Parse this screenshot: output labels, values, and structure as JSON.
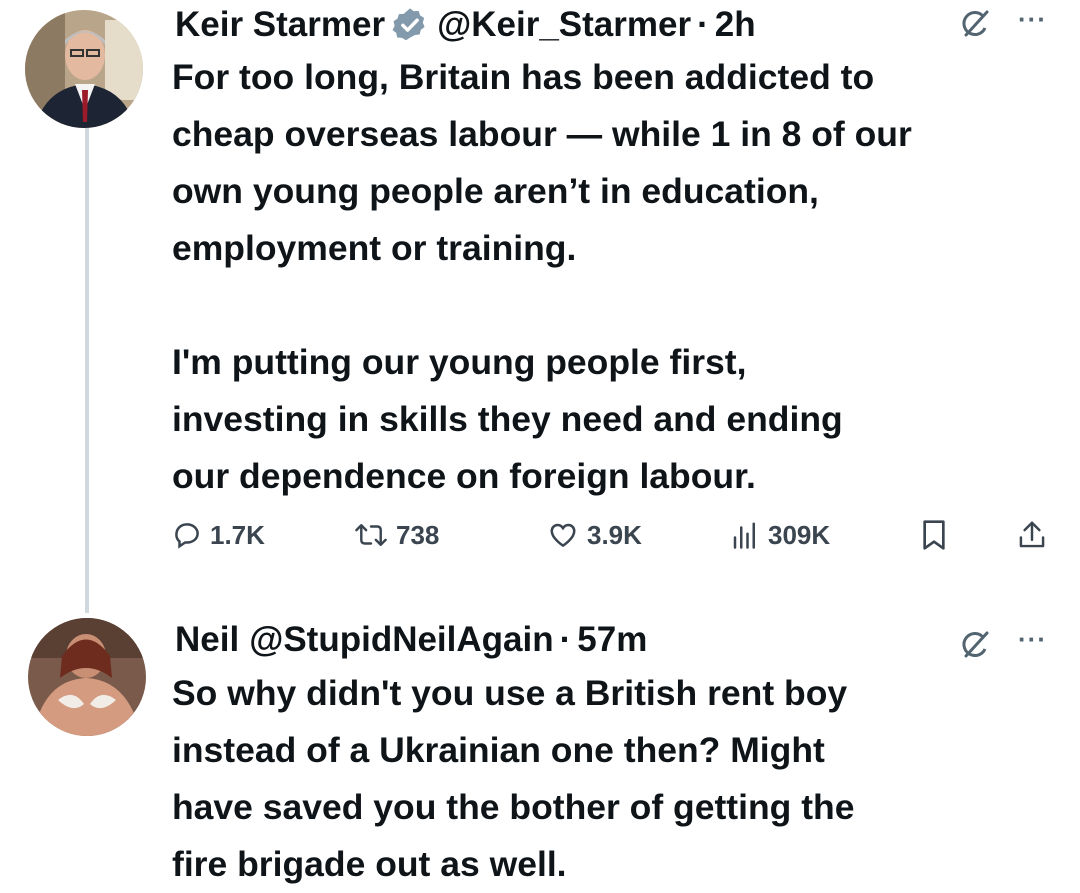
{
  "tweet": {
    "author_name": "Keir Starmer",
    "handle": "@Keir_Starmer",
    "separator": "·",
    "time": "2h",
    "text": "For too long, Britain has been addicted to\ncheap overseas labour — while 1 in 8 of our\nown young people aren’t in education,\nemployment or training.\n\nI'm putting our young people first,\ninvesting in skills they need and ending\nour dependence on foreign labour.",
    "stats": {
      "replies": "1.7K",
      "retweets": "738",
      "likes": "3.9K",
      "views": "309K"
    },
    "icons": {
      "verified": "verified-badge-icon",
      "grok": "grok-icon",
      "more": "more-icon",
      "reply": "reply-icon",
      "retweet": "retweet-icon",
      "like": "heart-icon",
      "views": "views-icon",
      "bookmark": "bookmark-icon",
      "share": "share-icon"
    }
  },
  "reply": {
    "author_name": "Neil",
    "handle": "@StupidNeilAgain",
    "separator": "·",
    "time": "57m",
    "text": "So why didn't you use a British rent boy\ninstead of a Ukrainian one then? Might\nhave saved you the bother of getting the\nfire brigade out as well."
  },
  "colors": {
    "text": "#0f1419",
    "muted": "#536471",
    "thread_line": "#cfd9de",
    "verified_badge": "#829aab"
  }
}
